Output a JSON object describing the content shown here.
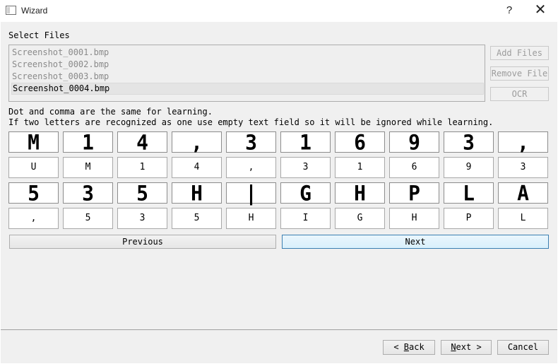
{
  "window": {
    "title": "Wizard",
    "help_label": "?",
    "close_label": "✕"
  },
  "files": {
    "label": "Select Files",
    "items": [
      "Screenshot_0001.bmp",
      "Screenshot_0002.bmp",
      "Screenshot_0003.bmp",
      "Screenshot_0004.bmp"
    ],
    "selected_index": 3
  },
  "side_buttons": {
    "add_files": "Add Files",
    "remove_file": "Remove File",
    "ocr": "OCR"
  },
  "hints": {
    "line1": "Dot and comma are the same for learning.",
    "line2": "If two letters are recognized as one use empty text field so it will be ignored while learning."
  },
  "letters": {
    "row1_glyphs": [
      "M",
      "1",
      "4",
      ",",
      "3",
      "1",
      "6",
      "9",
      "3",
      ","
    ],
    "row1_values": [
      "U",
      "M",
      "1",
      "4",
      ",",
      "3",
      "1",
      "6",
      "9",
      "3"
    ],
    "row2_glyphs": [
      "5",
      "3",
      "5",
      "H",
      "|",
      "G",
      "H",
      "P",
      "L",
      "A"
    ],
    "row2_values": [
      ",",
      "5",
      "3",
      "5",
      "H",
      "I",
      "G",
      "H",
      "P",
      "L"
    ]
  },
  "letter_nav": {
    "previous": "Previous",
    "next": "Next"
  },
  "footer": {
    "back_prefix": "< ",
    "back_accel": "B",
    "back_rest": "ack",
    "next_accel": "N",
    "next_rest": "ext >",
    "cancel": "Cancel"
  }
}
